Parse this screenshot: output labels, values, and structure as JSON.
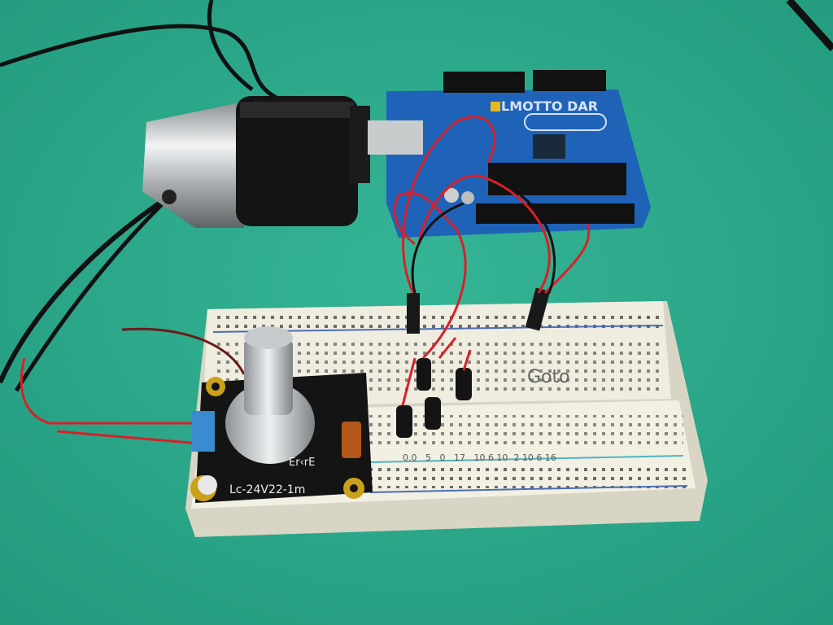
{
  "scene": {
    "background_color": "#2fae8f",
    "arduino": {
      "label": "LMOTTO DAR",
      "board_color": "#1f63b8"
    },
    "breadboard": {
      "handwritten": "Goto",
      "row_numbers": "0.0   5   0   17   10 6 10  2 10 6 16"
    },
    "potentiometer_module": {
      "label": "Lc-24V22-1m",
      "side_text": "Er‹rE"
    },
    "wire_colors": {
      "red": "#d8202a",
      "black": "#1a1a1a"
    }
  }
}
